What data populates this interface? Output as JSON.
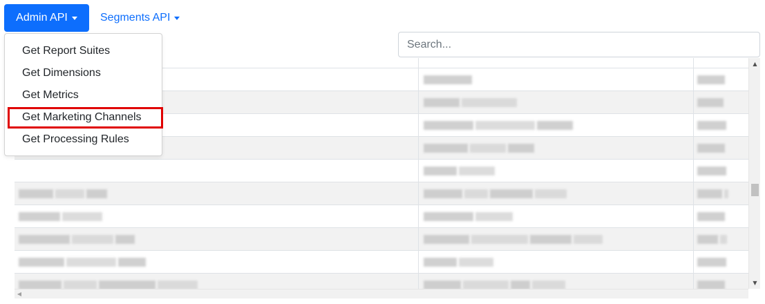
{
  "nav": {
    "admin_api_label": "Admin API",
    "segments_api_label": "Segments API"
  },
  "dropdown": {
    "items": [
      {
        "label": "Get Report Suites"
      },
      {
        "label": "Get Dimensions"
      },
      {
        "label": "Get Metrics"
      },
      {
        "label": "Get Marketing Channels",
        "highlighted": true
      },
      {
        "label": "Get Processing Rules"
      }
    ]
  },
  "search": {
    "placeholder": "Search...",
    "value": ""
  },
  "table": {
    "content_state": "blurred",
    "visible_row_count": 10
  },
  "colors": {
    "primary": "#0d6efd",
    "highlight_border": "#e00000",
    "row_striped": "#f2f2f2",
    "row_plain": "#ffffff"
  },
  "icons": {
    "caret": "caret-down-icon",
    "scroll_up": "arrow-up-icon",
    "scroll_down": "arrow-down-icon",
    "scroll_left": "arrow-left-icon"
  }
}
